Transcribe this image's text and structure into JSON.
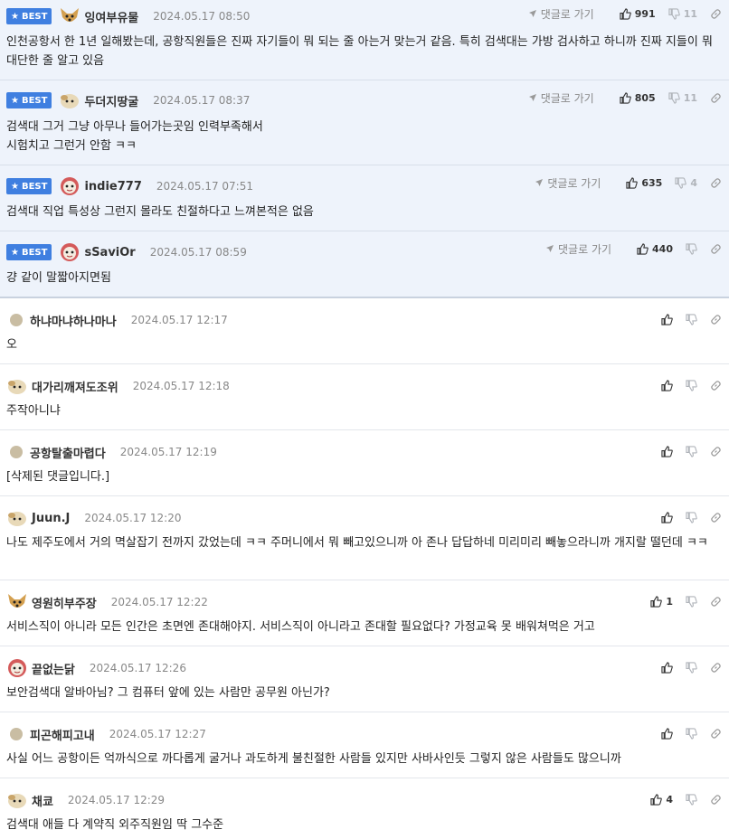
{
  "reply_label": "댓글로 가기",
  "best_label": "BEST",
  "best_comments": [
    {
      "nick": "잉여부유물",
      "date": "2024.05.17 08:50",
      "likes": "991",
      "dislikes": "11",
      "body": "인천공항서 한 1년 일해봤는데, 공항직원들은 진짜 자기들이 뭐 되는 줄 아는거 맞는거 같음. 특히 검색대는 가방 검사하고 하니까 진짜 지들이 뭐 대단한 줄 알고 있음",
      "avatar": "dog-icon"
    },
    {
      "nick": "두더지땅굴",
      "date": "2024.05.17 08:37",
      "likes": "805",
      "dislikes": "11",
      "body": "검색대 그거 그냥 아무나 들어가는곳임 인력부족해서\n시험치고 그런거 안함 ㅋㅋ",
      "avatar": "blob-icon"
    },
    {
      "nick": "indie777",
      "date": "2024.05.17 07:51",
      "likes": "635",
      "dislikes": "4",
      "body": "검색대 직업 특성상 그런지 몰라도 친절하다고 느껴본적은 없음",
      "avatar": "clown-icon"
    },
    {
      "nick": "sSaviOr",
      "date": "2024.05.17 08:59",
      "likes": "440",
      "dislikes": "",
      "body": "걍 같이 말짧아지면됨",
      "avatar": "clown-icon"
    }
  ],
  "comments": [
    {
      "nick": "하냐마냐하나마나",
      "date": "2024.05.17 12:17",
      "likes": "",
      "body": "오",
      "avatar": "dot-icon"
    },
    {
      "nick": "대가리깨져도조위",
      "date": "2024.05.17 12:18",
      "likes": "",
      "body": "주작아니냐",
      "avatar": "blob-icon"
    },
    {
      "nick": "공항탈출마렵다",
      "date": "2024.05.17 12:19",
      "likes": "",
      "body": "[삭제된 댓글입니다.]",
      "avatar": "dot-icon"
    },
    {
      "nick": "Juun.J",
      "date": "2024.05.17 12:20",
      "likes": "",
      "body": "나도 제주도에서 거의 멱살잡기 전까지 갔었는데 ㅋㅋ 주머니에서 뭐 빼고있으니까 아 존나 답답하네 미리미리 빼놓으라니까 개지랄 떨던데 ㅋㅋ",
      "avatar": "blob-icon"
    },
    {
      "nick": "영원히부주장",
      "date": "2024.05.17 12:22",
      "likes": "1",
      "body": "서비스직이 아니라 모든 인간은 초면엔 존대해야지. 서비스직이 아니라고 존대할 필요없다? 가정교육 못 배워쳐먹은 거고",
      "avatar": "dog-icon"
    },
    {
      "nick": "끝없는닭",
      "date": "2024.05.17 12:26",
      "likes": "",
      "body": "보안검색대 알바아님? 그 컴퓨터 앞에 있는 사람만 공무원 아닌가?",
      "avatar": "clown-icon"
    },
    {
      "nick": "피곤해피고내",
      "date": "2024.05.17 12:27",
      "likes": "",
      "body": "사실 어느 공항이든 억까식으로 까다롭게 굴거나 과도하게 불친절한 사람들 있지만 사바사인듯 그렇지 않은 사람들도 많으니까",
      "avatar": "dot-icon"
    },
    {
      "nick": "채쿄",
      "date": "2024.05.17 12:29",
      "likes": "4",
      "body": "검색대 애들 다 계약직 외주직원임 딱 그수준",
      "avatar": "blob-icon"
    }
  ]
}
